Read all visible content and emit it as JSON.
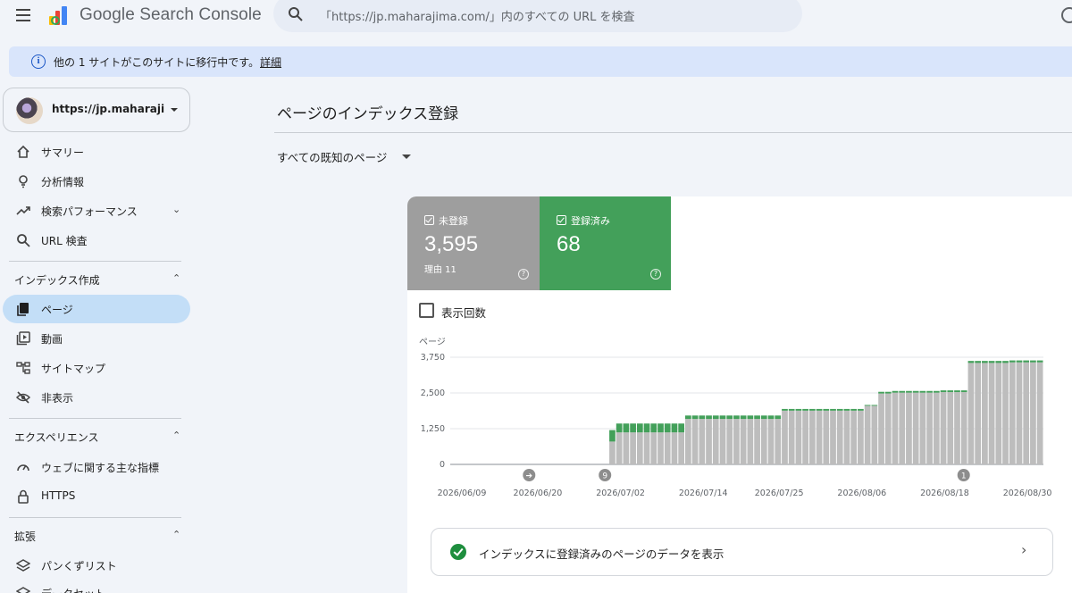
{
  "app": {
    "title": "Google Search Console",
    "search_placeholder": "「https://jp.maharajima.com/」内のすべての URL を検査"
  },
  "banner": {
    "text": "他の 1 サイトがこのサイトに移行中です。",
    "link": "詳細"
  },
  "sidebar": {
    "property": "https://jp.maharajima.com/",
    "items_top": [
      {
        "label": "サマリー",
        "icon": "home-icon"
      },
      {
        "label": "分析情報",
        "icon": "lightbulb-icon"
      },
      {
        "label": "検索パフォーマンス",
        "icon": "trending-icon"
      },
      {
        "label": "URL 検査",
        "icon": "search-icon"
      }
    ],
    "section_index": "インデックス作成",
    "items_index": [
      {
        "label": "ページ",
        "icon": "pages-icon"
      },
      {
        "label": "動画",
        "icon": "video-icon"
      },
      {
        "label": "サイトマップ",
        "icon": "sitemap-icon"
      },
      {
        "label": "非表示",
        "icon": "hidden-icon"
      }
    ],
    "section_experience": "エクスペリエンス",
    "items_experience": [
      {
        "label": "ウェブに関する主な指標",
        "icon": "speed-icon"
      },
      {
        "label": "HTTPS",
        "icon": "lock-icon"
      }
    ],
    "section_enhancements": "拡張",
    "items_enhancements": [
      {
        "label": "パンくずリスト",
        "icon": "layers-icon"
      },
      {
        "label": "データセット",
        "icon": "layers-icon"
      }
    ]
  },
  "main": {
    "title": "ページのインデックス登録",
    "filter": "すべての既知のページ",
    "metrics": {
      "not_indexed": {
        "label": "未登録",
        "value": "3,595",
        "sub": "理由 11"
      },
      "indexed": {
        "label": "登録済み",
        "value": "68"
      }
    },
    "impressions_label": "表示回数",
    "data_row_label": "インデックスに登録済みのページのデータを表示"
  },
  "colors": {
    "not_indexed": "#9e9e9e",
    "indexed": "#43a05a",
    "accent": "#c3def7"
  },
  "chart_data": {
    "type": "bar",
    "stacked": true,
    "ylabel": "ページ",
    "ylim": [
      0,
      3750
    ],
    "yticks": [
      "3,750",
      "2,500",
      "1,250",
      "0"
    ],
    "yticks_values": [
      3750,
      2500,
      1250,
      0
    ],
    "x_labels": [
      "2026/06/09",
      "2026/06/20",
      "2026/07/02",
      "2026/07/14",
      "2026/07/25",
      "2026/08/06",
      "2026/08/18",
      "2026/08/30"
    ],
    "x_label_days": [
      0,
      11,
      23,
      35,
      46,
      58,
      70,
      82
    ],
    "days": [
      23,
      24,
      25,
      26,
      27,
      28,
      29,
      30,
      31,
      32,
      33,
      34,
      35,
      36,
      37,
      38,
      39,
      40,
      41,
      42,
      43,
      44,
      45,
      46,
      47,
      48,
      49,
      50,
      51,
      52,
      53,
      54,
      55,
      56,
      57,
      58,
      59,
      60,
      61,
      62,
      63,
      64,
      65,
      66,
      67,
      68,
      69,
      70,
      71,
      72,
      73,
      74,
      75,
      76,
      77,
      78,
      79,
      80,
      81,
      82,
      83,
      84,
      85
    ],
    "series": [
      {
        "name": "未登録",
        "values": [
          800,
          1120,
          1120,
          1120,
          1120,
          1120,
          1120,
          1120,
          1120,
          1120,
          1120,
          1590,
          1590,
          1590,
          1590,
          1590,
          1590,
          1590,
          1590,
          1590,
          1590,
          1590,
          1590,
          1590,
          1590,
          1880,
          1880,
          1880,
          1880,
          1880,
          1880,
          1880,
          1880,
          1880,
          1880,
          1880,
          1880,
          2050,
          2050,
          2480,
          2480,
          2510,
          2510,
          2510,
          2510,
          2510,
          2510,
          2510,
          2530,
          2530,
          2530,
          2530,
          3550,
          3550,
          3550,
          3550,
          3550,
          3550,
          3570,
          3570,
          3570,
          3570,
          3570,
          3570
        ]
      },
      {
        "name": "登録済み",
        "values": [
          400,
          310,
          310,
          310,
          310,
          310,
          310,
          310,
          310,
          310,
          310,
          120,
          120,
          120,
          120,
          120,
          120,
          120,
          120,
          120,
          120,
          120,
          120,
          120,
          120,
          60,
          60,
          60,
          60,
          60,
          60,
          60,
          60,
          60,
          60,
          60,
          60,
          30,
          30,
          60,
          60,
          60,
          60,
          60,
          60,
          60,
          60,
          60,
          60,
          60,
          60,
          60,
          70,
          70,
          70,
          70,
          70,
          70,
          68,
          68,
          68,
          68,
          68,
          68
        ]
      }
    ],
    "annotations": [
      {
        "day": 11,
        "label": "➔"
      },
      {
        "day": 22,
        "label": "9"
      },
      {
        "day": 74,
        "label": "1"
      }
    ]
  }
}
